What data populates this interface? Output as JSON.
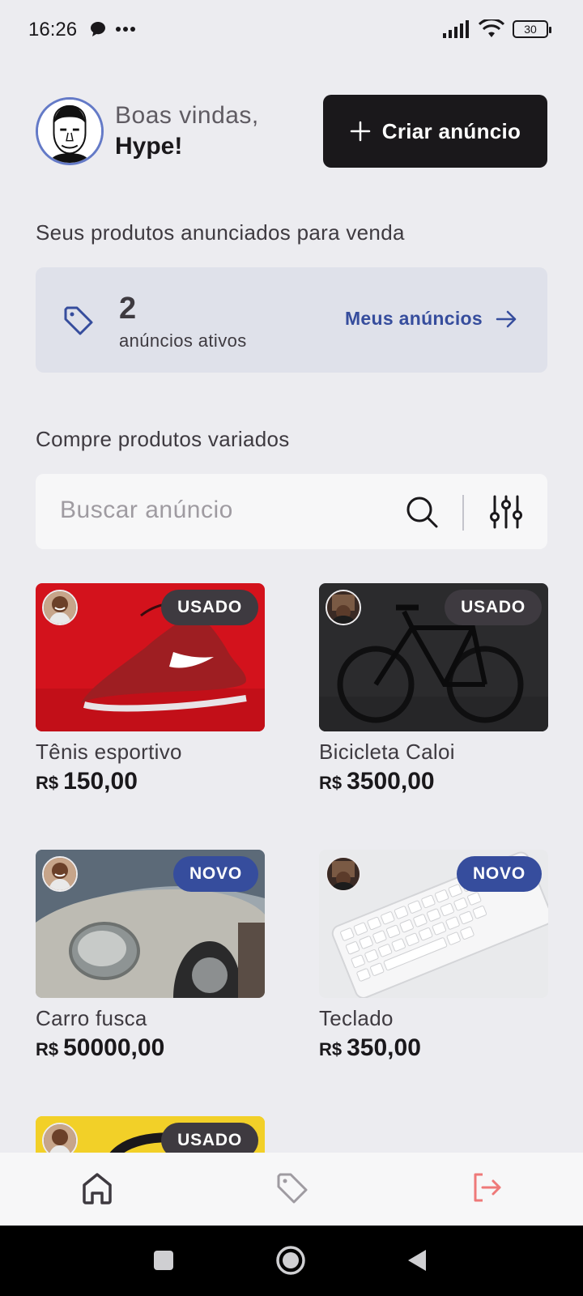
{
  "status": {
    "time": "16:26",
    "battery": "30"
  },
  "header": {
    "greeting": "Boas vindas,",
    "user_name": "Hype!",
    "create_button": "Criar anúncio"
  },
  "my_ads": {
    "section_title": "Seus produtos anunciados para venda",
    "count": "2",
    "label": "anúncios ativos",
    "link": "Meus anúncios"
  },
  "shop": {
    "section_title": "Compre produtos variados",
    "search_placeholder": "Buscar anúncio"
  },
  "products": [
    {
      "name": "Tênis esportivo",
      "currency": "R$",
      "price": "150,00",
      "condition": "USADO"
    },
    {
      "name": "Bicicleta Caloi",
      "currency": "R$",
      "price": "3500,00",
      "condition": "USADO"
    },
    {
      "name": "Carro fusca",
      "currency": "R$",
      "price": "50000,00",
      "condition": "NOVO"
    },
    {
      "name": "Teclado",
      "currency": "R$",
      "price": "350,00",
      "condition": "NOVO"
    },
    {
      "condition": "USADO"
    }
  ],
  "bottom_nav": [
    "home-icon",
    "tag-icon",
    "sign-out-icon"
  ],
  "colors": {
    "dark": "#1A181B",
    "blue": "#364D9D",
    "blue_light": "#647AC7",
    "gray_bg": "#ECECF0",
    "red_logout": "#EE7979"
  }
}
